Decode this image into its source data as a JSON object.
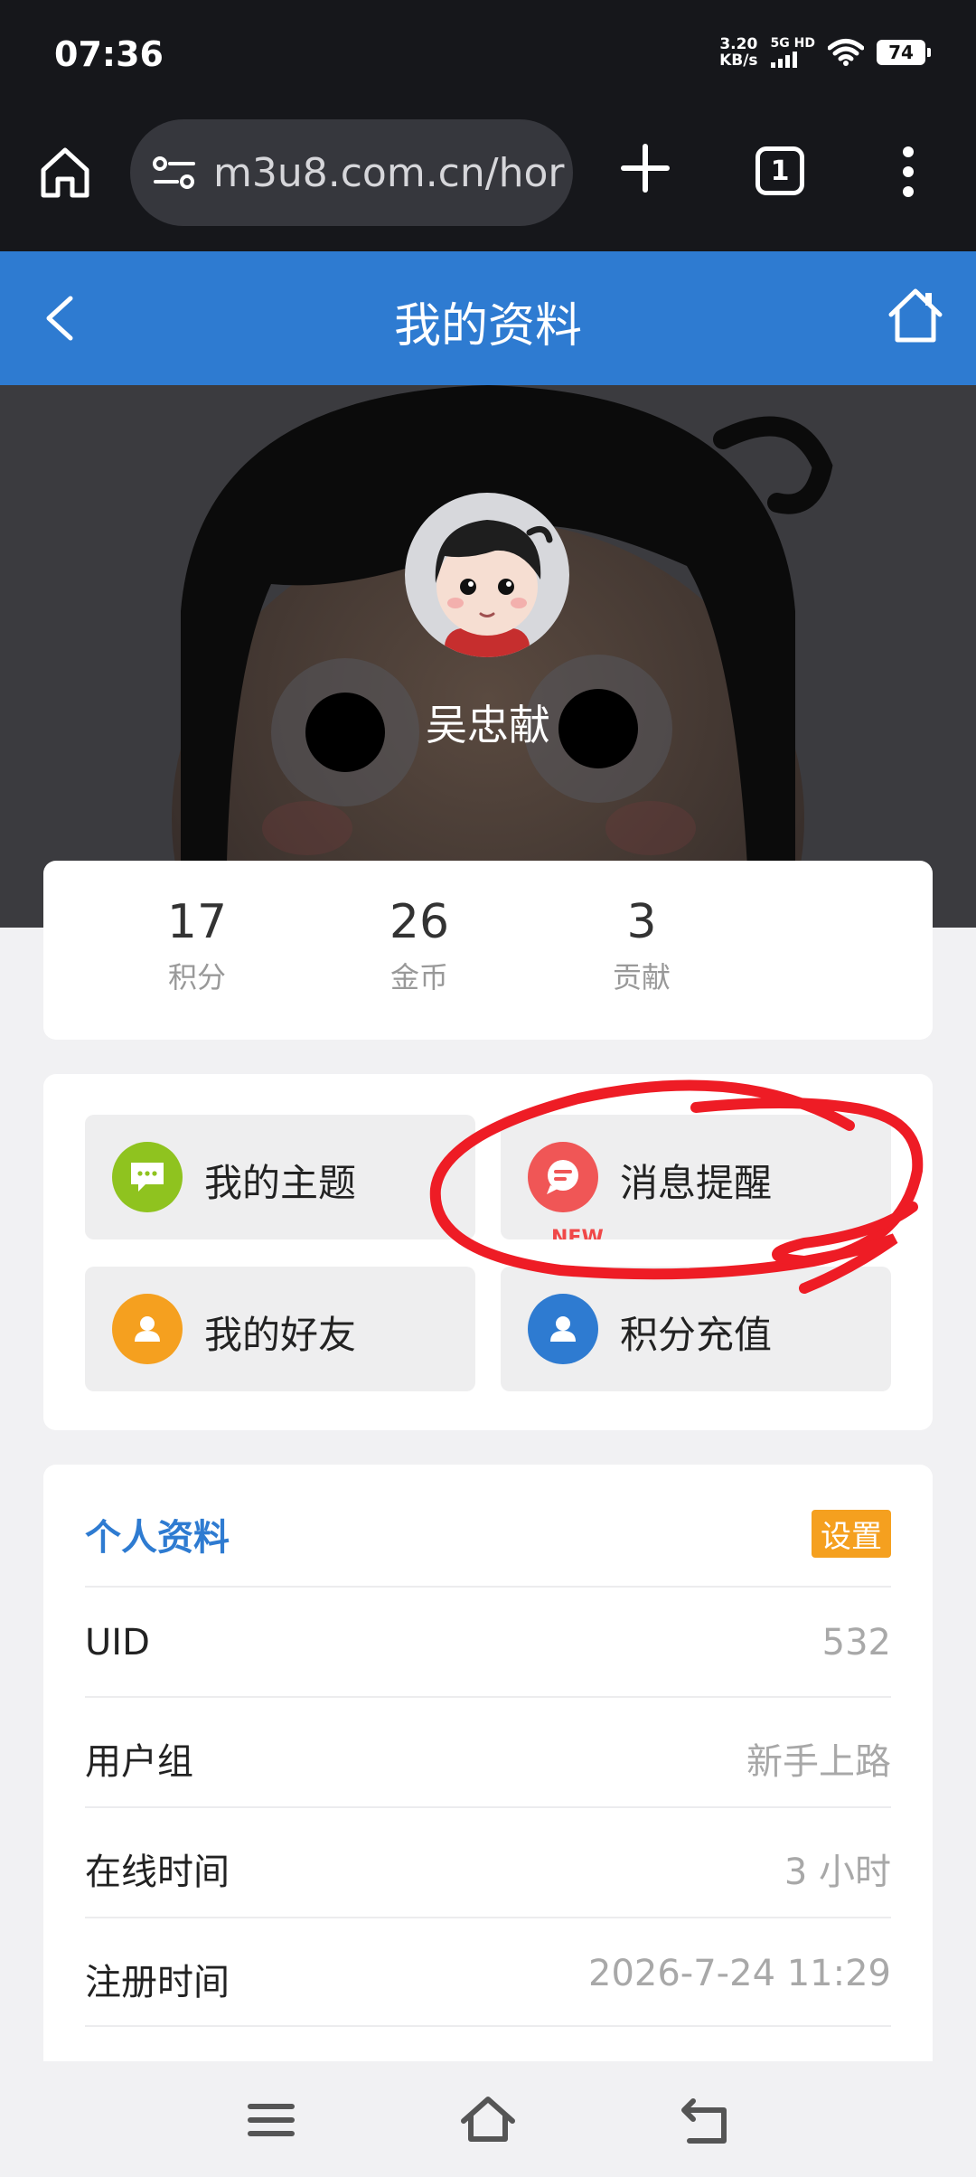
{
  "status_bar": {
    "time": "07:36",
    "net_speed_value": "3.20",
    "net_speed_unit": "KB/s",
    "signal_label": "5G HD",
    "battery": "74"
  },
  "browser": {
    "url": "m3u8.com.cn/hor",
    "tab_count": "1",
    "icons": [
      "home-icon",
      "site-settings-icon",
      "plus-icon",
      "tabs-icon",
      "more-vert-icon"
    ]
  },
  "header": {
    "title": "我的资料",
    "icons": [
      "back-chevron-icon",
      "home-icon"
    ]
  },
  "profile": {
    "username": "吴忠献"
  },
  "stats": [
    {
      "value": "17",
      "label": "积分"
    },
    {
      "value": "26",
      "label": "金币"
    },
    {
      "value": "3",
      "label": "贡献"
    }
  ],
  "menu": [
    {
      "label": "我的主题",
      "icon": "chat-bubble-icon",
      "color": "#8fc31f"
    },
    {
      "label": "消息提醒",
      "icon": "message-icon",
      "color": "#f05656",
      "badge": "NEW"
    },
    {
      "label": "我的好友",
      "icon": "user-icon",
      "color": "#f5a01f"
    },
    {
      "label": "积分充值",
      "icon": "user-icon",
      "color": "#2e7bd1"
    }
  ],
  "profile_card": {
    "title": "个人资料",
    "setting_label": "设置",
    "rows": [
      {
        "key": "UID",
        "value": "532"
      },
      {
        "key": "用户组",
        "value": "新手上路"
      },
      {
        "key": "在线时间",
        "value": "3 小时"
      },
      {
        "key": "注册时间",
        "value": "2026-7-24 11:29"
      }
    ]
  },
  "colors": {
    "header_blue": "#2e7bd1",
    "annotation_red": "#ee1c25"
  }
}
